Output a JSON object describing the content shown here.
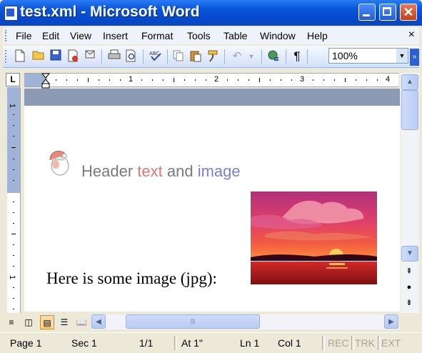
{
  "window": {
    "title": "test.xml - Microsoft Word",
    "close_glyph": "✕"
  },
  "menubar": {
    "items": [
      "File",
      "Edit",
      "View",
      "Insert",
      "Format",
      "Tools",
      "Table",
      "Window",
      "Help"
    ],
    "close_glyph": "×"
  },
  "toolbar": {
    "icons": [
      "new-document-icon",
      "open-folder-icon",
      "save-icon",
      "permission-icon",
      "email-icon",
      "print-icon",
      "print-preview-icon",
      "spelling-icon",
      "copy-icon",
      "paste-icon",
      "format-painter-icon",
      "undo-icon",
      "undo-dropdown-icon",
      "hyperlink-icon",
      "show-formatting-icon"
    ],
    "zoom_value": "100%",
    "pilcrow": "¶"
  },
  "ruler": {
    "tab_selector": "L",
    "h_numbers": [
      "1",
      "2",
      "3",
      "4"
    ],
    "v_numbers": [
      "1",
      "1"
    ]
  },
  "document": {
    "header_words": [
      {
        "text": "Header ",
        "color": "#7A7A7A"
      },
      {
        "text": "text",
        "color": "#E07A70"
      },
      {
        "text": " and ",
        "color": "#7A7A7A"
      },
      {
        "text": "image",
        "color": "#7A80D8"
      }
    ],
    "body_text": "Here is some image (jpg):"
  },
  "status": {
    "page": "Page 1",
    "sec": "Sec 1",
    "pages": "1/1",
    "at": "At 1\"",
    "ln": "Ln 1",
    "col": "Col 1",
    "rec": "REC",
    "trk": "TRK",
    "ext": "EXT"
  }
}
